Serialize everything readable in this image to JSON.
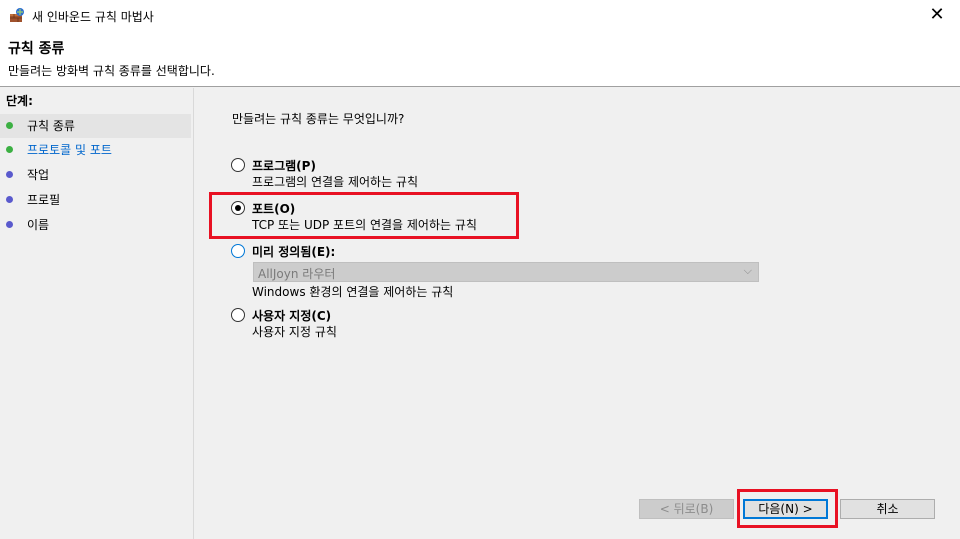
{
  "window": {
    "title": "새 인바운드 규칙 마법사",
    "close_glyph": "✕"
  },
  "header": {
    "title": "규칙 종류",
    "description": "만들려는 방화벽 규칙 종류를 선택합니다."
  },
  "sidebar": {
    "heading": "단계:",
    "steps": [
      {
        "label": "규칙 종류",
        "dot_color": "#3cb043",
        "active": true
      },
      {
        "label": "프로토콜 및 포트",
        "dot_color": "#3cb043",
        "link": true
      },
      {
        "label": "작업",
        "dot_color": "#5a5acd"
      },
      {
        "label": "프로필",
        "dot_color": "#5a5acd"
      },
      {
        "label": "이름",
        "dot_color": "#5a5acd"
      }
    ]
  },
  "main": {
    "question": "만들려는 규칙 종류는 무엇입니까?",
    "options": [
      {
        "label": "프로그램(P)",
        "description": "프로그램의 연결을 제어하는 규칙",
        "selected": false
      },
      {
        "label": "포트(O)",
        "description": "TCP 또는 UDP 포트의 연결을 제어하는 규칙",
        "selected": true
      },
      {
        "label": "미리 정의됨(E):",
        "description": "Windows 환경의 연결을 제어하는 규칙",
        "selected": false
      },
      {
        "label": "사용자 지정(C)",
        "description": "사용자 지정 규칙",
        "selected": false
      }
    ],
    "predefined_combo": {
      "value": "AllJoyn 라우터",
      "arrow": "⌵"
    }
  },
  "buttons": {
    "back": "< 뒤로(B)",
    "next": "다음(N) >",
    "cancel": "취소"
  },
  "colors": {
    "highlight": "#e81123",
    "accent": "#0078d7"
  }
}
